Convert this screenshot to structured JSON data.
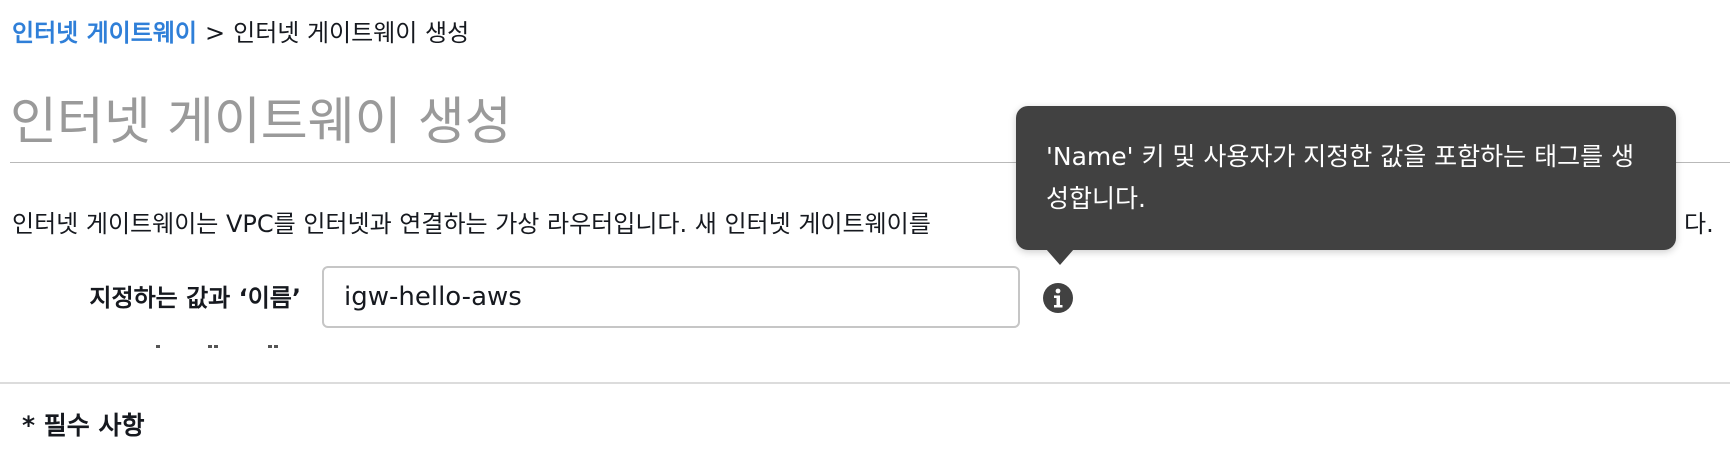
{
  "breadcrumb": {
    "parent": "인터넷 게이트웨이",
    "separator": ">",
    "current": "인터넷 게이트웨이 생성"
  },
  "page_title": "인터넷 게이트웨이 생성",
  "description": {
    "visible_start": "인터넷 게이트웨이는 VPC를 인터넷과 연결하는 가상 라우터입니다. 새 인터넷 게이트웨이를",
    "visible_end": "다."
  },
  "form": {
    "name_tag_label": "지정하는 값과 ‘이름’",
    "name_tag_value": "igw-hello-aws"
  },
  "tooltip": {
    "text": "'Name' 키 및 사용자가 지정한 값을 포함하는 태그를 생성합니다."
  },
  "required_note": "* 필수 사항",
  "colors": {
    "link": "#2f7fd8",
    "title": "#9a9a9a",
    "tooltip_bg": "#414141",
    "info_icon": "#414141"
  },
  "icons": {
    "info": "info-icon"
  }
}
